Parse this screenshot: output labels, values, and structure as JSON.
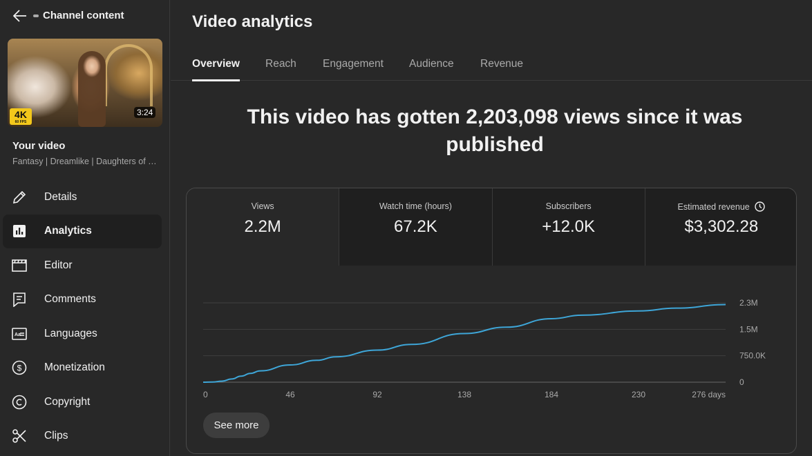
{
  "sidebar": {
    "header_label": "Channel content",
    "thumbnail": {
      "badge": "4K",
      "badge_sub": "60 FPS",
      "duration": "3:24"
    },
    "your_video_label": "Your video",
    "video_title": "Fantasy | Dreamlike | Daughters of t…",
    "items": [
      {
        "label": "Details",
        "icon": "pencil-icon",
        "active": false
      },
      {
        "label": "Analytics",
        "icon": "analytics-icon",
        "active": true
      },
      {
        "label": "Editor",
        "icon": "clapperboard-icon",
        "active": false
      },
      {
        "label": "Comments",
        "icon": "comment-icon",
        "active": false
      },
      {
        "label": "Languages",
        "icon": "subtitles-icon",
        "active": false
      },
      {
        "label": "Monetization",
        "icon": "dollar-icon",
        "active": false
      },
      {
        "label": "Copyright",
        "icon": "copyright-icon",
        "active": false
      },
      {
        "label": "Clips",
        "icon": "scissors-icon",
        "active": false
      }
    ]
  },
  "main": {
    "title": "Video analytics",
    "tabs": [
      {
        "label": "Overview",
        "active": true
      },
      {
        "label": "Reach",
        "active": false
      },
      {
        "label": "Engagement",
        "active": false
      },
      {
        "label": "Audience",
        "active": false
      },
      {
        "label": "Revenue",
        "active": false
      }
    ],
    "headline": "This video has gotten 2,203,098 views since it was published",
    "metrics": [
      {
        "label": "Views",
        "value": "2.2M"
      },
      {
        "label": "Watch time (hours)",
        "value": "67.2K"
      },
      {
        "label": "Subscribers",
        "value": "+12.0K"
      },
      {
        "label": "Estimated revenue",
        "value": "$3,302.28"
      }
    ],
    "see_more": "See more"
  },
  "colors": {
    "background": "#282828",
    "sidebar_active": "#1f1f1f",
    "line": "#3ea6d8",
    "text": "#f1f1f1",
    "muted": "#aaaaaa"
  },
  "chart_data": {
    "type": "line",
    "series": [
      {
        "x": [
          0,
          5,
          10,
          15,
          20,
          25,
          30,
          46,
          60,
          70,
          92,
          110,
          138,
          160,
          184,
          200,
          230,
          250,
          276
        ],
        "values": [
          0,
          5000,
          30000,
          90000,
          170000,
          250000,
          320000,
          490000,
          620000,
          720000,
          910000,
          1070000,
          1380000,
          1560000,
          1800000,
          1900000,
          2020000,
          2100000,
          2200000
        ]
      }
    ],
    "x_ticks": [
      "0",
      "46",
      "92",
      "138",
      "184",
      "230",
      "276 days"
    ],
    "y_ticks": [
      "0",
      "750.0K",
      "1.5M",
      "2.3M"
    ],
    "y_tick_values": [
      0,
      750000,
      1500000,
      2250000
    ],
    "xlim": [
      0,
      276
    ],
    "ylim": [
      0,
      2250000
    ],
    "grid": true
  }
}
